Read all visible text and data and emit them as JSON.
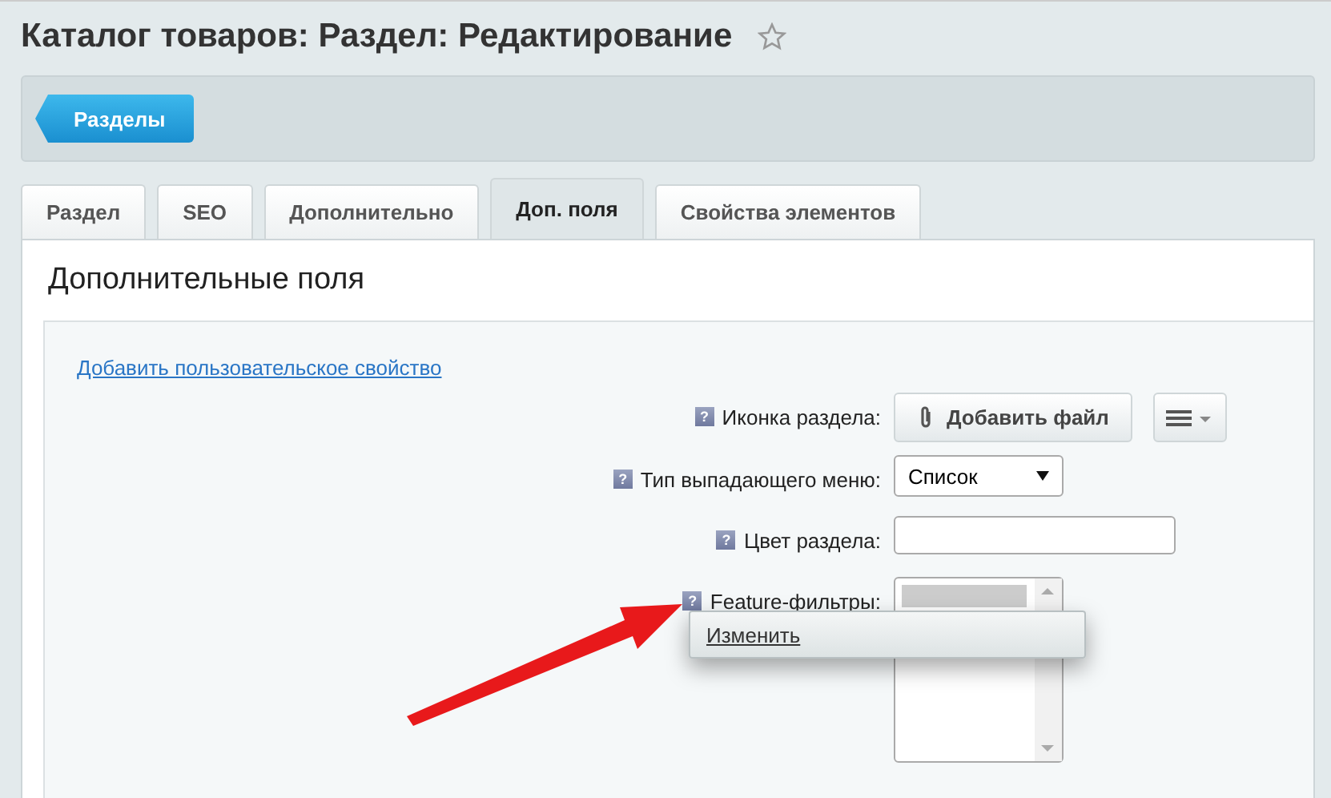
{
  "window": {
    "title": "Каталог товаров: Раздел: Редактирование",
    "favorite": false
  },
  "toolbar": {
    "back_button": "Разделы"
  },
  "tabs": [
    {
      "label": "Раздел",
      "selected": false
    },
    {
      "label": "SEO",
      "selected": false
    },
    {
      "label": "Дополнительно",
      "selected": false
    },
    {
      "label": "Доп. поля",
      "selected": true
    },
    {
      "label": "Свойства элементов",
      "selected": false
    }
  ],
  "panel": {
    "title": "Дополнительные поля",
    "add_link": "Добавить пользовательское свойство",
    "fields": [
      {
        "kind": "file",
        "label": "Иконка раздела:",
        "help": "?",
        "button": "Добавить файл"
      },
      {
        "kind": "select",
        "label": "Тип выпадающего меню:",
        "help": "?",
        "value": "Список"
      },
      {
        "kind": "text",
        "label": "Цвет раздела:",
        "help": "?"
      },
      {
        "kind": "multiselect",
        "label": "Feature-фильтры:",
        "help": "?"
      }
    ],
    "popup_menu": {
      "items": [
        "Изменить"
      ]
    }
  }
}
